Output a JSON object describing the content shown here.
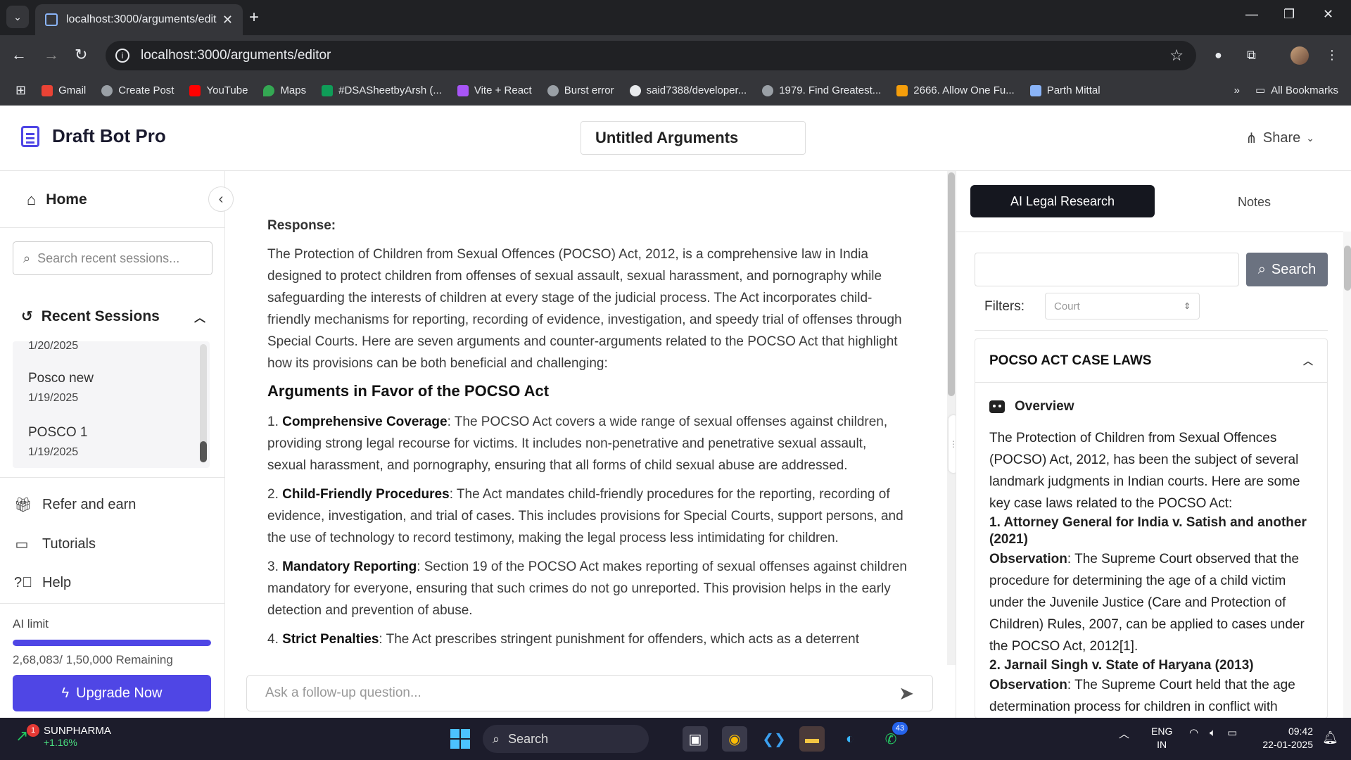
{
  "browser": {
    "tab_title": "localhost:3000/arguments/editor",
    "url": "localhost:3000/arguments/editor",
    "bookmarks": [
      {
        "label": "Gmail",
        "color": "#ea4335"
      },
      {
        "label": "Create Post",
        "color": "#9aa0a6"
      },
      {
        "label": "YouTube",
        "color": "#ff0000"
      },
      {
        "label": "Maps",
        "color": "#34a853"
      },
      {
        "label": "#DSASheetbyArsh (...",
        "color": "#0f9d58"
      },
      {
        "label": "Vite + React",
        "color": "#a855f7"
      },
      {
        "label": "Burst error",
        "color": "#9aa0a6"
      },
      {
        "label": "said7388/developer...",
        "color": "#e8eaed"
      },
      {
        "label": "1979. Find Greatest...",
        "color": "#9aa0a6"
      },
      {
        "label": "2666. Allow One Fu...",
        "color": "#f59e0b"
      },
      {
        "label": "Parth Mittal",
        "color": "#8ab4f8"
      }
    ],
    "all_bookmarks": "All Bookmarks"
  },
  "app": {
    "brand": "Draft Bot Pro",
    "doc_title": "Untitled Arguments",
    "share_label": "Share"
  },
  "sidebar": {
    "home_label": "Home",
    "search_placeholder": "Search recent sessions...",
    "recent_title": "Recent Sessions",
    "sessions": [
      {
        "name": "",
        "date": "1/20/2025"
      },
      {
        "name": "Posco new",
        "date": "1/19/2025"
      },
      {
        "name": "POSCO 1",
        "date": "1/19/2025"
      }
    ],
    "links": [
      {
        "label": "Refer and earn",
        "icon": "gift-icon"
      },
      {
        "label": "Tutorials",
        "icon": "video-icon"
      },
      {
        "label": "Help",
        "icon": "help-icon"
      }
    ],
    "ai_limit_label": "AI limit",
    "ai_limit_fraction": 1.0,
    "ai_limit_text": "2,68,083/ 1,50,000 Remaining",
    "upgrade_label": "Upgrade Now"
  },
  "document": {
    "response_label": "Response:",
    "intro": "The Protection of Children from Sexual Offences (POCSO) Act, 2012, is a comprehensive law in India designed to protect children from offenses of sexual assault, sexual harassment, and pornography while safeguarding the interests of children at every stage of the judicial process. The Act incorporates child-friendly mechanisms for reporting, recording of evidence, investigation, and speedy trial of offenses through Special Courts. Here are seven arguments and counter-arguments related to the POCSO Act that highlight how its provisions can be both beneficial and challenging:",
    "heading": "Arguments in Favor of the POCSO Act",
    "points": [
      {
        "num": "1.",
        "title": "Comprehensive Coverage",
        "text": ": The POCSO Act covers a wide range of sexual offenses against children, providing strong legal recourse for victims. It includes non-penetrative and penetrative sexual assault, sexual harassment, and pornography, ensuring that all forms of child sexual abuse are addressed."
      },
      {
        "num": "2.",
        "title": "Child-Friendly Procedures",
        "text": ": The Act mandates child-friendly procedures for the reporting, recording of evidence, investigation, and trial of cases. This includes provisions for Special Courts, support persons, and the use of technology to record testimony, making the legal process less intimidating for children."
      },
      {
        "num": "3.",
        "title": "Mandatory Reporting",
        "text": ": Section 19 of the POCSO Act makes reporting of sexual offenses against children mandatory for everyone, ensuring that such crimes do not go unreported. This provision helps in the early detection and prevention of abuse."
      },
      {
        "num": "4.",
        "title": "Strict Penalties",
        "text": ": The Act prescribes stringent punishment for offenders, which acts as a deterrent"
      }
    ],
    "followup_placeholder": "Ask a follow-up question..."
  },
  "research": {
    "tab_ai": "AI Legal Research",
    "tab_notes": "Notes",
    "search_button": "Search",
    "filters_label": "Filters:",
    "court_placeholder": "Court",
    "card_title": "POCSO ACT CASE LAWS",
    "overview_label": "Overview",
    "overview_text": "The Protection of Children from Sexual Offences (POCSO) Act, 2012, has been the subject of several landmark judgments in Indian courts. Here are some key case laws related to the POCSO Act:",
    "cases": [
      {
        "num": "1.",
        "title": "Attorney General for India v. Satish and another (2021)",
        "obs_label": "Observation",
        "obs": ": The Supreme Court observed that the procedure for determining the age of a child victim under the Juvenile Justice (Care and Protection of Children) Rules, 2007, can be applied to cases under the POCSO Act, 2012[1]."
      },
      {
        "num": "2.",
        "title": "Jarnail Singh v. State of Haryana (2013)",
        "obs_label": "Observation",
        "obs": ": The Supreme Court held that the age determination process for children in conflict with"
      }
    ]
  },
  "taskbar": {
    "stock_name": "SUNPHARMA",
    "stock_change": "+1.16%",
    "stock_badge": "1",
    "search_label": "Search",
    "whatsapp_badge": "43",
    "lang_top": "ENG",
    "lang_bottom": "IN",
    "time": "09:42",
    "date": "22-01-2025"
  }
}
